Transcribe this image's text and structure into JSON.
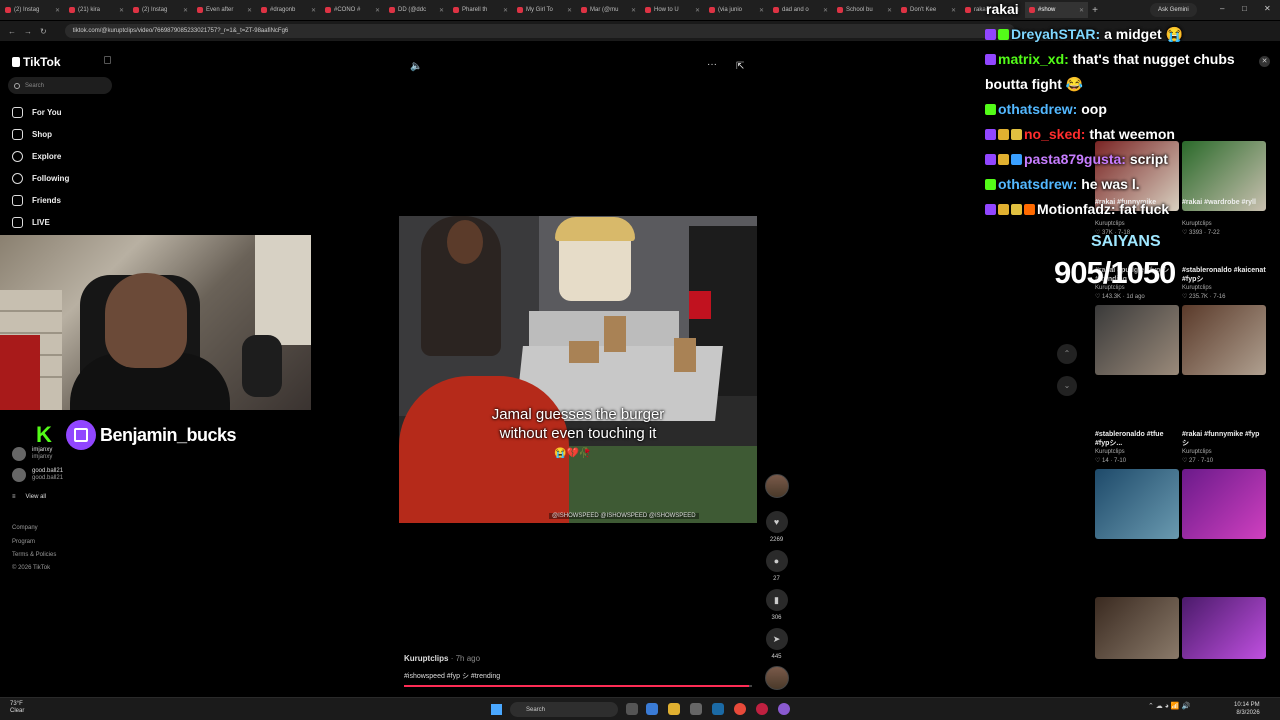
{
  "browser": {
    "tabs": [
      "(2) Instag",
      "(21) kira",
      "(2) Instag",
      "Even after",
      "#dragonb",
      "#CONO #",
      "DD (@ddc",
      "Pharell th",
      "My Girl To",
      "Mar (@mu",
      "How to U",
      "(via junio",
      "dad and o",
      "School bu",
      "Don't Kee",
      "rakai",
      "#show"
    ],
    "active_tab_index": 16,
    "ask_gemini": "Ask Gemini",
    "url": "tiktok.com/@kuruptclips/video/7669879085233021757?_r=1&_t=ZT-98aafiNcFg6"
  },
  "sidebar": {
    "brand": "TikTok",
    "search_placeholder": "Search",
    "nav": [
      {
        "label": "For You",
        "icon": "home-icon"
      },
      {
        "label": "Shop",
        "icon": "shop-icon"
      },
      {
        "label": "Explore",
        "icon": "compass-icon"
      },
      {
        "label": "Following",
        "icon": "following-icon"
      },
      {
        "label": "Friends",
        "icon": "friends-icon"
      },
      {
        "label": "LIVE",
        "icon": "live-icon"
      }
    ],
    "following_accounts": [
      {
        "name": "imjanxy",
        "handle": "imjanxy"
      },
      {
        "name": "good.ball21",
        "handle": "good.ball21"
      }
    ],
    "view_all": "View all",
    "footer": [
      "Company",
      "Program",
      "Terms & Policies",
      "© 2026 TikTok"
    ]
  },
  "stream_overlay": {
    "streamer_name": "Benjamin_bucks",
    "kick_logo": "K"
  },
  "video": {
    "caption_line1": "Jamal guesses the burger",
    "caption_line2": "without even touching it",
    "caption_emoji": "😭💔🥀",
    "watermark_handles": "@ISHOWSPEED  @ISHOWSPEED  @ISHOWSPEED",
    "author": "Kuruptclips",
    "posted": "· 7h ago",
    "hashtags": "#ishowspeed #fyp シ #trending",
    "progress": 0.99,
    "likes": "2269",
    "comments": "27",
    "saves": "306",
    "shares": "445"
  },
  "chat": {
    "header_name": "rakai",
    "messages": [
      {
        "user": "DreyahSTAR:",
        "text": "a midget 😭",
        "color": "#7fd7ff",
        "badges": [
          "#9146ff",
          "#53fc18"
        ]
      },
      {
        "user": "matrix_xd:",
        "text": "that's that nugget chubs",
        "color": "#53fc18",
        "badges": [
          "#9146ff"
        ]
      },
      {
        "user": "",
        "text": "boutta fight 😂",
        "color": "#ffffff",
        "badges": []
      },
      {
        "user": "othatsdrew:",
        "text": "oop",
        "color": "#53b8ff",
        "badges": [
          "#53fc18"
        ]
      },
      {
        "user": "no_sked:",
        "text": "that weemon",
        "color": "#ff2d2d",
        "badges": [
          "#9146ff",
          "#e0b030",
          "#e0c040"
        ]
      },
      {
        "user": "pasta879gusta:",
        "text": "script",
        "color": "#c77dff",
        "badges": [
          "#9146ff",
          "#e0b030",
          "#3aa0ff"
        ]
      },
      {
        "user": "othatsdrew:",
        "text": "he was l.",
        "color": "#53b8ff",
        "badges": [
          "#53fc18"
        ]
      },
      {
        "user": "Motionfadz:",
        "text": "fat fuck",
        "color": "#ffffff",
        "badges": [
          "#9146ff",
          "#e0b030",
          "#e0c040",
          "#ff6a00"
        ]
      }
    ],
    "goal_label": "SAIYANS",
    "goal_counter": "905/1050"
  },
  "related": [
    {
      "title": "#rakai #funnymike",
      "user": "Kuruptclips",
      "meta": "♡ 37K · 7-18",
      "thumb": [
        "#7a2525",
        "#d8d0c0"
      ]
    },
    {
      "title": "#rakai #wardrobe #ryll",
      "user": "Kuruptclips",
      "meta": "♡ 3393 · 7-22",
      "thumb": [
        "#2a6a2a",
        "#c9c0b0"
      ]
    },
    {
      "title": "#rakai #pudgie #fyp シ #trending",
      "user": "Kuruptclips",
      "meta": "♡ 143.3K · 1d ago",
      "thumb": [
        "#3a3a3a",
        "#9a8a7a"
      ]
    },
    {
      "title": "#stableronaldo #kaicenat #fypシ",
      "user": "Kuruptclips",
      "meta": "♡ 235.7K · 7-16",
      "thumb": [
        "#5a3a2a",
        "#b0a090"
      ]
    },
    {
      "title": "#stableronaldo #tfue #fypシ...",
      "user": "Kuruptclips",
      "meta": "♡ 14 · 7-10",
      "thumb": [
        "#1e4a6a",
        "#6a9ab0"
      ]
    },
    {
      "title": "#rakai #funnymike #fypシ",
      "user": "Kuruptclips",
      "meta": "♡ 27 · 7-10",
      "thumb": [
        "#6a1a8a",
        "#d040c0"
      ]
    },
    {
      "title": "",
      "user": "",
      "meta": "",
      "thumb": [
        "#3a2a20",
        "#8a7a6a"
      ]
    },
    {
      "title": "",
      "user": "",
      "meta": "",
      "thumb": [
        "#4a1a6a",
        "#c050e0"
      ]
    }
  ],
  "taskbar": {
    "temperature": "73°F",
    "weather": "Clear",
    "search": "Search",
    "time": "10:14 PM",
    "date": "8/3/2026"
  }
}
